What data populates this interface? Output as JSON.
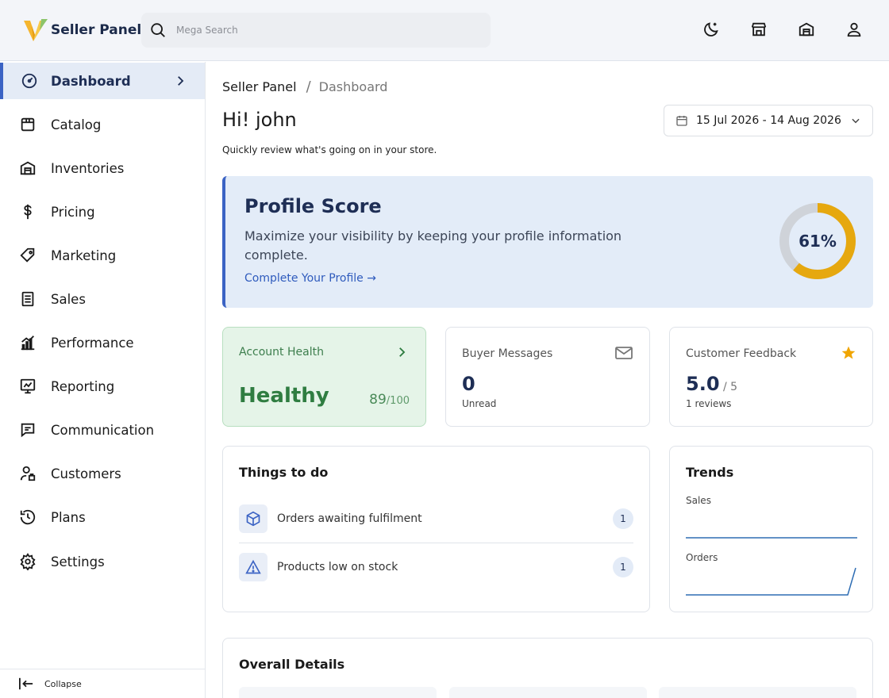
{
  "app": {
    "name": "Seller Panel",
    "colors": {
      "accent": "#3b63c4",
      "health_green": "#2f7d41",
      "gauge_yellow": "#e6a80f",
      "star": "#f0a500"
    }
  },
  "search": {
    "placeholder": "Mega Search"
  },
  "header_icons": [
    "moon-icon",
    "storefront-icon",
    "warehouse-icon",
    "user-icon"
  ],
  "sidebar": {
    "items": [
      {
        "label": "Dashboard",
        "icon": "gauge-icon",
        "active": true
      },
      {
        "label": "Catalog",
        "icon": "catalog-icon"
      },
      {
        "label": "Inventories",
        "icon": "warehouse-icon"
      },
      {
        "label": "Pricing",
        "icon": "dollar-icon"
      },
      {
        "label": "Marketing",
        "icon": "tag-icon"
      },
      {
        "label": "Sales",
        "icon": "receipt-icon"
      },
      {
        "label": "Performance",
        "icon": "bar-chart-icon"
      },
      {
        "label": "Reporting",
        "icon": "report-icon"
      },
      {
        "label": "Communication",
        "icon": "chat-icon"
      },
      {
        "label": "Customers",
        "icon": "customers-icon"
      },
      {
        "label": "Plans",
        "icon": "history-icon"
      },
      {
        "label": "Settings",
        "icon": "gear-icon"
      }
    ],
    "collapse_label": "Collapse"
  },
  "breadcrumb": {
    "root": "Seller Panel",
    "sep": "/",
    "current": "Dashboard"
  },
  "greeting": "Hi! john",
  "subtitle": "Quickly review what's going on in your store.",
  "date_range": "15 Jul 2026 - 14 Aug 2026",
  "profile_score": {
    "title": "Profile Score",
    "description": "Maximize your visibility by keeping your profile information complete.",
    "link": "Complete Your Profile →",
    "percent": 61,
    "percent_label": "61%"
  },
  "account_health": {
    "title": "Account Health",
    "status": "Healthy",
    "score": "89",
    "max": "/100"
  },
  "buyer_messages": {
    "title": "Buyer Messages",
    "value": "0",
    "sub": "Unread"
  },
  "customer_feedback": {
    "title": "Customer Feedback",
    "value": "5.0",
    "max": " / 5",
    "sub": "1 reviews"
  },
  "todo": {
    "title": "Things to do",
    "items": [
      {
        "label": "Orders awaiting fulfilment",
        "count": "1",
        "icon": "box-icon"
      },
      {
        "label": "Products low on stock",
        "count": "1",
        "icon": "warning-icon"
      }
    ]
  },
  "trends": {
    "title": "Trends",
    "sales_label": "Sales",
    "orders_label": "Orders"
  },
  "overall": {
    "title": "Overall Details"
  }
}
